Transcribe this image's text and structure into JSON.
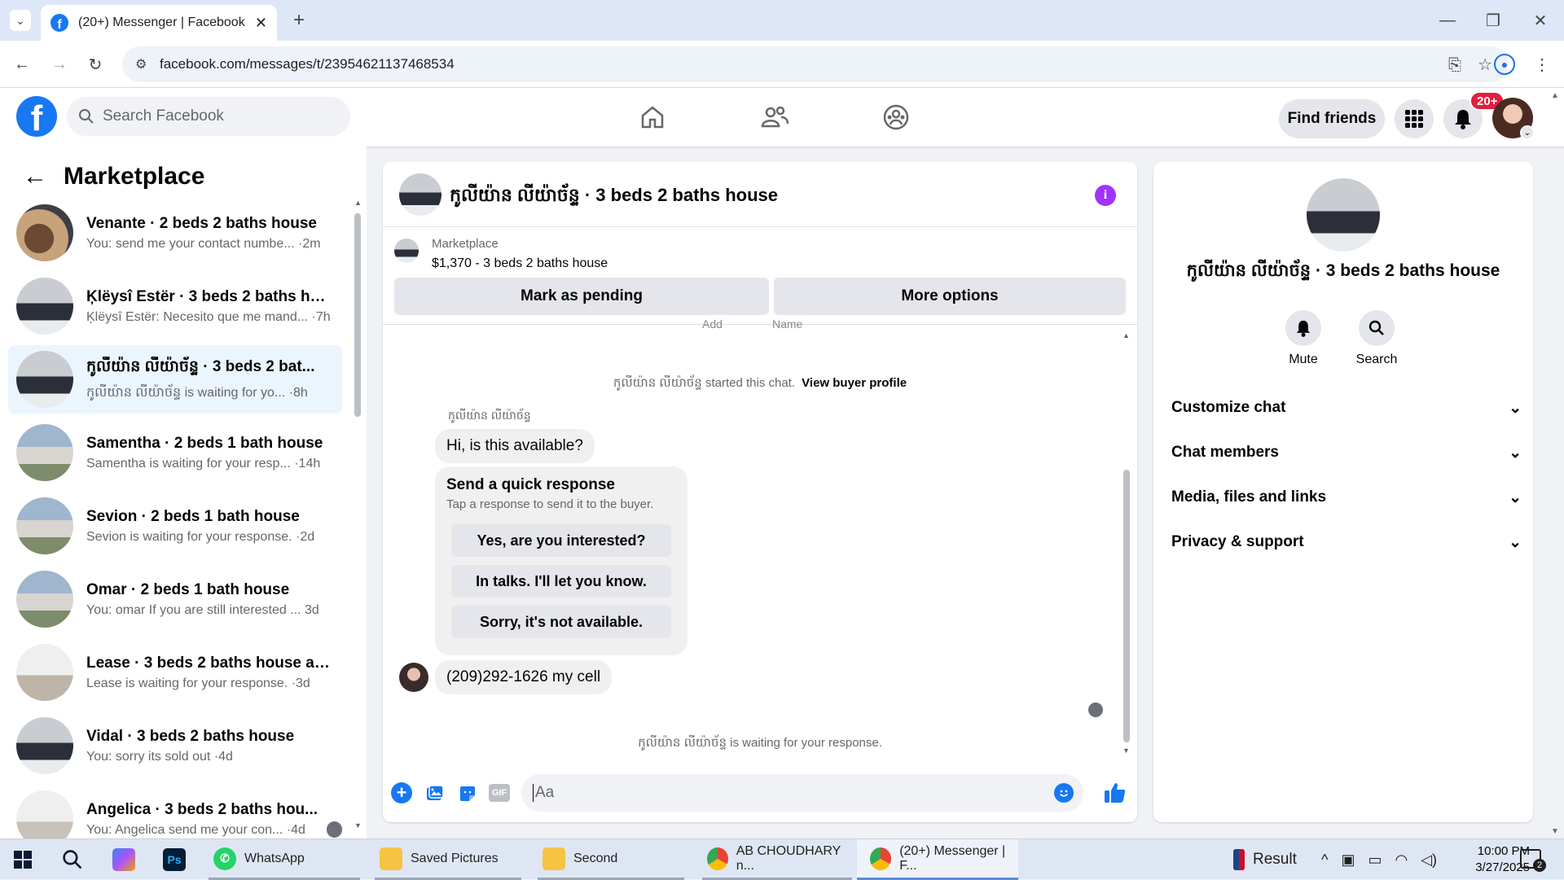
{
  "browser": {
    "tab_title": "(20+) Messenger | Facebook",
    "url": "facebook.com/messages/t/23954621137468534"
  },
  "fb": {
    "search_placeholder": "Search Facebook",
    "find_friends": "Find friends",
    "notif_badge": "20+"
  },
  "sidebar": {
    "title": "Marketplace",
    "conversations": [
      {
        "title": "Venante · 2 beds 2 baths house",
        "preview": "You: send me your contact numbe... ·2m"
      },
      {
        "title": "Ķlëysî Estër · 3 beds 2 baths house",
        "preview": "Ķlëysî Estër: Necesito que me mand... ·7h"
      },
      {
        "title": "កូលីយ៉ាន លីយ៉ាច័ន្ទ · 3 beds 2 bat...",
        "preview": "កូលីយ៉ាន លីយ៉ាច័ន្ទ is waiting for yo... ·8h"
      },
      {
        "title": "Samentha · 2 beds 1 bath house",
        "preview": "Samentha is waiting for your resp... ·14h"
      },
      {
        "title": "Sevion · 2 beds 1 bath house",
        "preview": "Sevion is waiting for your response. ·2d"
      },
      {
        "title": "Omar · 2 beds 1 bath house",
        "preview": "You: omar If you are still interested ... 3d"
      },
      {
        "title": "Lease · 3 beds 2 baths house at ...",
        "preview": "Lease is waiting for your response. ·3d"
      },
      {
        "title": "Vidal · 3 beds 2 baths house",
        "preview": "You: sorry its sold out ·4d"
      },
      {
        "title": "Angelica · 3 beds 2 baths hou...",
        "preview": "You: Angelica send me your con... ·4d"
      }
    ]
  },
  "chat": {
    "title": "កូលីយ៉ាន លីយ៉ាច័ន្ទ · 3 beds 2 baths house",
    "listing_source": "Marketplace",
    "listing_info": "$1,370 - 3 beds 2 baths house",
    "mark_pending": "Mark as pending",
    "more_options": "More options",
    "cut_text_1": "Add",
    "cut_text_2": "Name",
    "started_prefix": "កូលីយ៉ាន លីយ៉ាច័ន្ទ started this chat.",
    "view_profile": "View buyer profile",
    "sender_name": "កូលីយ៉ាន លីយ៉ាច័ន្ទ",
    "msg1": "Hi, is this available?",
    "quick_title": "Send a quick response",
    "quick_sub": "Tap a response to send it to the buyer.",
    "quick_responses": [
      "Yes, are you interested?",
      "In talks. I'll let you know.",
      "Sorry, it's not available."
    ],
    "msg2": "(209)292-1626 my cell",
    "waiting": "កូលីយ៉ាន លីយ៉ាច័ន្ទ is waiting for your response.",
    "input_placeholder": "Aa",
    "gif": "GIF"
  },
  "details": {
    "name": "កូលីយ៉ាន លីយ៉ាច័ន្ទ · 3 beds 2 baths house",
    "mute": "Mute",
    "search": "Search",
    "sections": [
      "Customize chat",
      "Chat members",
      "Media, files and links",
      "Privacy & support"
    ]
  },
  "taskbar": {
    "whatsapp": "WhatsApp",
    "saved_pictures": "Saved Pictures",
    "second": "Second",
    "chrome1": "AB CHOUDHARY n...",
    "chrome2": "(20+) Messenger | F...",
    "result": "Result",
    "time": "10:00 PM",
    "date": "3/27/2025",
    "notif_count": "2"
  },
  "colors": {
    "brand": "#1877f2",
    "accent_purple": "#a033ff",
    "badge": "#e41e3f"
  }
}
